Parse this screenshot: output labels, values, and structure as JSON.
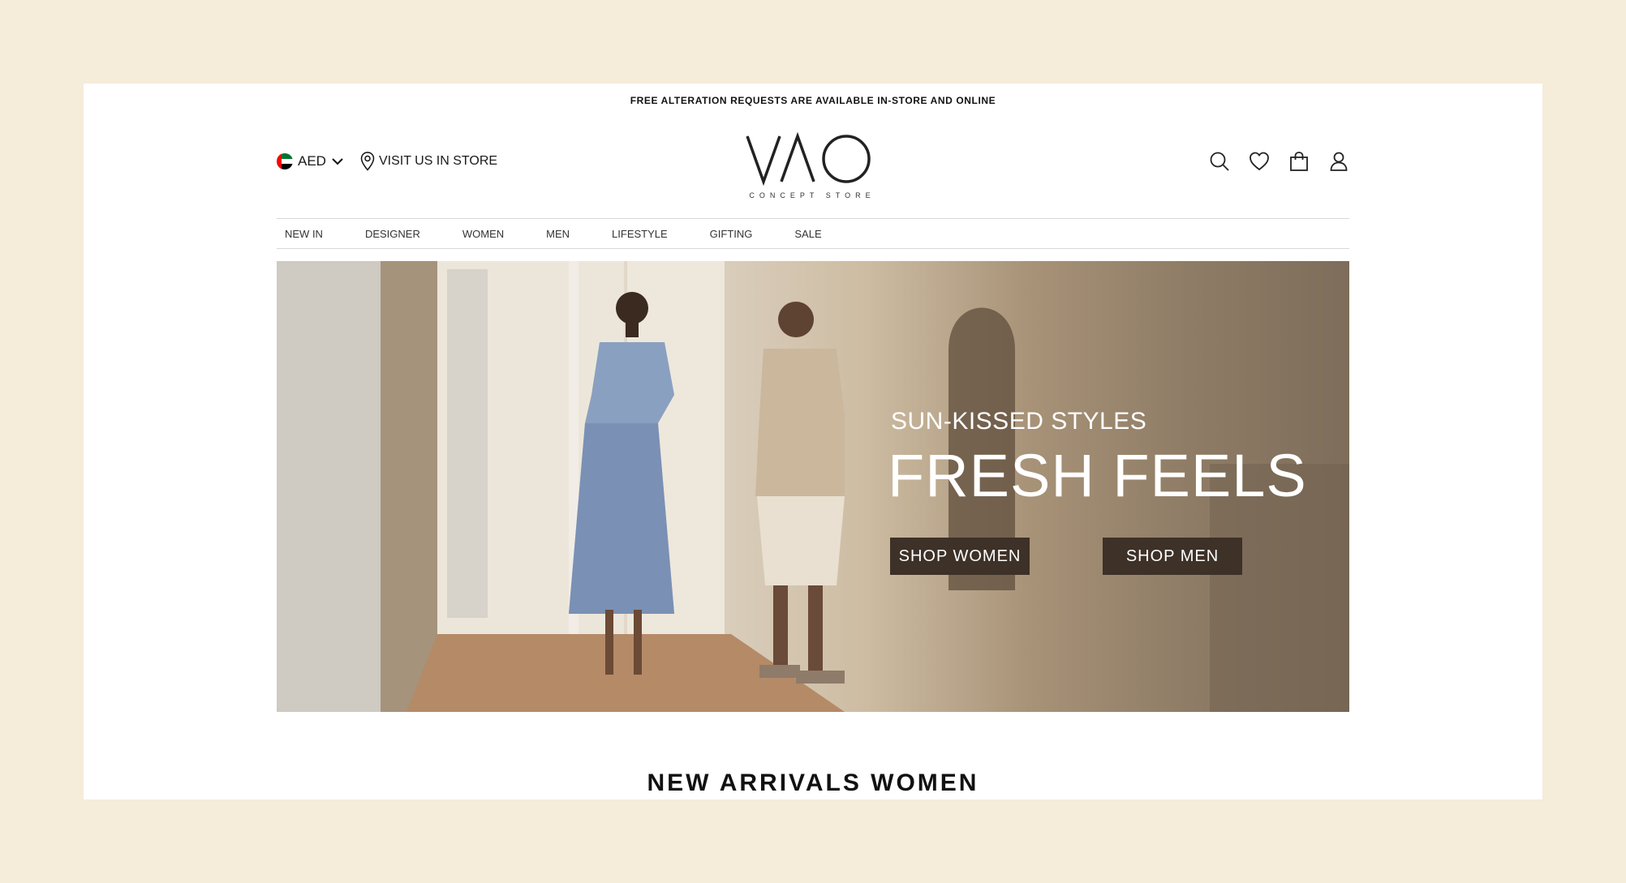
{
  "announcement": "FREE ALTERATION REQUESTS ARE AVAILABLE IN-STORE AND ONLINE",
  "header": {
    "currency": "AED",
    "store_link": "VISIT US IN STORE",
    "logo_text": "VAO",
    "logo_sub": "CONCEPT STORE",
    "icons": [
      "search-icon",
      "heart-icon",
      "bag-icon",
      "user-icon"
    ]
  },
  "nav": {
    "items": [
      "NEW IN",
      "DESIGNER",
      "WOMEN",
      "MEN",
      "LIFESTYLE",
      "GIFTING",
      "SALE"
    ]
  },
  "hero": {
    "subtitle": "SUN-KISSED STYLES",
    "title": "FRESH FEELS",
    "button_women": "SHOP WOMEN",
    "button_men": "SHOP MEN"
  },
  "section": {
    "title": "NEW ARRIVALS WOMEN"
  },
  "colors": {
    "page_bg": "#f5ecd9",
    "button_bg": "#3d3128",
    "text": "#1a1a1a"
  }
}
